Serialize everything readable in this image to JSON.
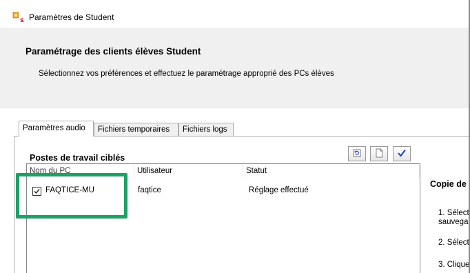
{
  "window": {
    "title": "Paramètres de Student",
    "icon": "student-app-icon"
  },
  "header": {
    "title": "Paramétrage des clients élèves Student",
    "subtitle": "Sélectionnez vos préférences et effectuez le paramétrage approprié des PCs élèves"
  },
  "tabs": [
    {
      "label": "Paramètres audio",
      "active": true
    },
    {
      "label": "Fichiers temporaires",
      "active": false
    },
    {
      "label": "Fichiers logs",
      "active": false
    }
  ],
  "section": {
    "title": "Postes de travail ciblés"
  },
  "toolbar": {
    "buttons": [
      {
        "icon": "refresh-icon"
      },
      {
        "icon": "document-icon"
      },
      {
        "icon": "checkmark-icon"
      }
    ]
  },
  "table": {
    "columns": [
      "Nom du PC",
      "Utilisateur",
      "Statut"
    ],
    "rows": [
      {
        "checked": true,
        "name": "FAQTICE-MU",
        "user": "faqtice",
        "status": "Réglage effectué"
      }
    ]
  },
  "right_panel": {
    "heading": "Copie de",
    "steps": [
      "1. Sélect",
      "sauvega",
      "2. Sélect",
      "3. Clique"
    ]
  },
  "colors": {
    "highlight": "#1ea065",
    "banner": "#f0f0f0",
    "check_blue": "#1a3fd6"
  }
}
